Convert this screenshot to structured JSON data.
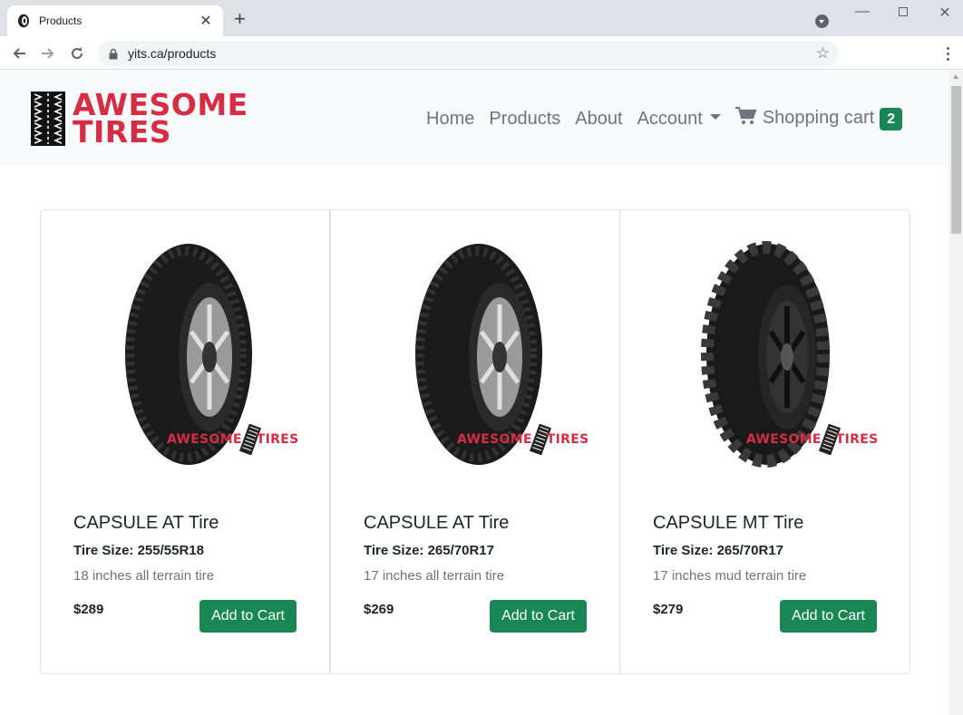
{
  "browser": {
    "tab_title": "Products",
    "url": "yits.ca/products"
  },
  "site": {
    "logo_line1": "AWESOME",
    "logo_line2": "TIRES",
    "nav": {
      "home": "Home",
      "products": "Products",
      "about": "About",
      "account": "Account",
      "cart": "Shopping cart",
      "cart_count": "2"
    },
    "watermark_left": "AWESOME",
    "watermark_right": "TIRES"
  },
  "products": [
    {
      "name": "CAPSULE AT Tire",
      "size": "Tire Size: 255/55R18",
      "description": "18 inches all terrain tire",
      "price": "$289",
      "button": "Add to Cart"
    },
    {
      "name": "CAPSULE AT Tire",
      "size": "Tire Size: 265/70R17",
      "description": "17 inches all terrain tire",
      "price": "$269",
      "button": "Add to Cart"
    },
    {
      "name": "CAPSULE MT Tire",
      "size": "Tire Size: 265/70R17",
      "description": "17 inches mud terrain tire",
      "price": "$279",
      "button": "Add to Cart"
    }
  ],
  "colors": {
    "brand_red": "#d62d45",
    "success_green": "#198754"
  }
}
